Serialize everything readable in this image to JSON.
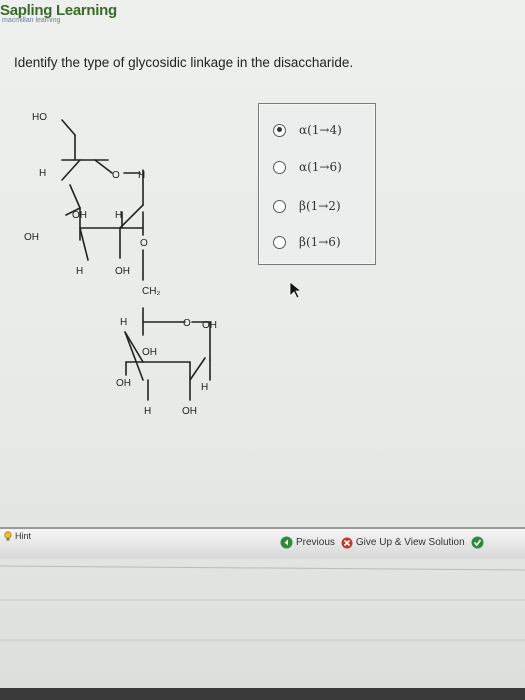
{
  "brand": {
    "name": "Sapling Learning",
    "subtitle": "macmillan learning"
  },
  "question": {
    "text": "Identify the type of glycosidic linkage in the disaccharide."
  },
  "structure": {
    "labels": {
      "ho_top": "HO",
      "h_c5": "H",
      "o_ring1": "O",
      "h_c1": "H",
      "oh_c4": "OH",
      "h_c2": "H",
      "oh_c4b": "OH",
      "h_c3": "H",
      "oh_c3": "OH",
      "o_link": "O",
      "ch2": "CH₂",
      "h_c5b": "H",
      "o_ring2": "O",
      "oh_c1b": "OH",
      "oh_c4c": "OH",
      "oh_c3b": "OH",
      "h_c2b": "H",
      "h_c3b": "H",
      "oh_c2b": "OH"
    }
  },
  "options": {
    "selected_index": 0,
    "items": [
      {
        "label": "α(1→4)"
      },
      {
        "label": "α(1→6)"
      },
      {
        "label": "β(1→2)"
      },
      {
        "label": "β(1→6)"
      }
    ]
  },
  "footer": {
    "hint_label": "Hint",
    "previous_label": "Previous",
    "giveup_label": "Give Up & View Solution"
  },
  "colors": {
    "brand_green": "#3b6b2a",
    "previous_icon": "#2e8b3e",
    "giveup_icon": "#c0392b",
    "check_icon": "#2e8b3e"
  }
}
